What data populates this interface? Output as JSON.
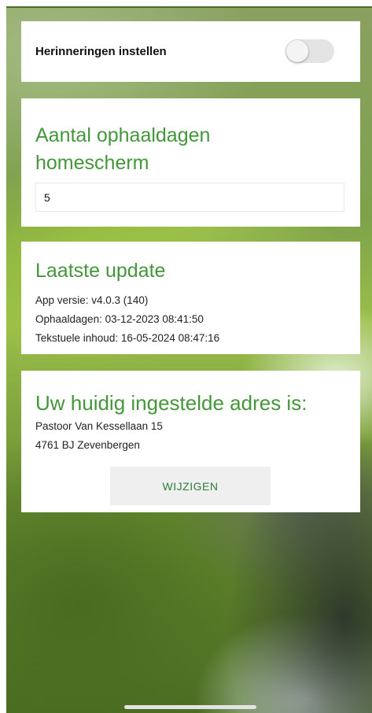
{
  "reminders": {
    "label": "Herinneringen instellen",
    "enabled": false
  },
  "home_days": {
    "title": "Aantal ophaaldagen homescherm",
    "value": "5"
  },
  "last_update": {
    "title": "Laatste update",
    "app_version": "App versie: v4.0.3 (140)",
    "collection_days": "Ophaaldagen: 03-12-2023 08:41:50",
    "text_content": "Tekstuele inhoud: 16-05-2024 08:47:16"
  },
  "address": {
    "title": "Uw huidig ingestelde adres is:",
    "street": "Pastoor Van Kessellaan 15",
    "city": "4761 BJ Zevenbergen",
    "change_label": "WIJZIGEN"
  },
  "colors": {
    "accent_green": "#43973a",
    "button_text_green": "#2f7d35",
    "card_background": "#ffffff"
  }
}
